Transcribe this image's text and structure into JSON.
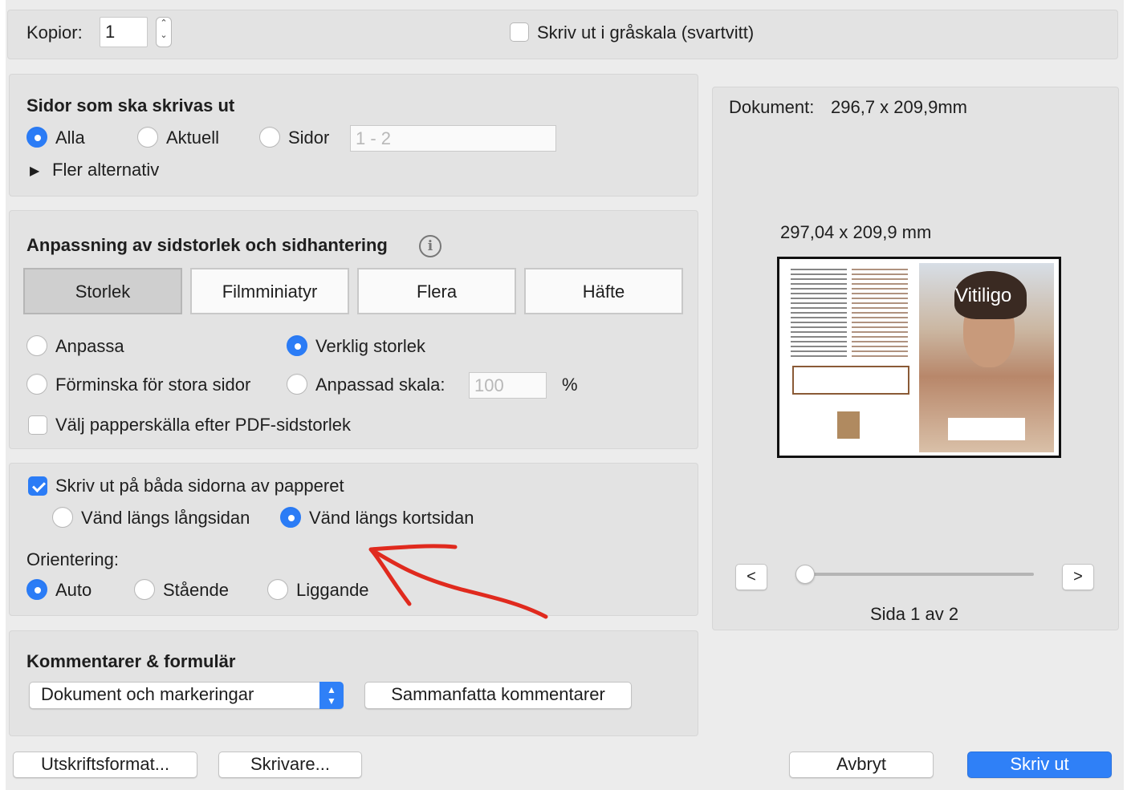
{
  "copies": {
    "label": "Kopior:",
    "value": "1"
  },
  "grayscale": {
    "label": "Skriv ut i gråskala (svartvitt)",
    "checked": false
  },
  "pages_section": {
    "title": "Sidor som ska skrivas ut",
    "options": [
      "Alla",
      "Aktuell",
      "Sidor"
    ],
    "selected": "Alla",
    "range_placeholder": "1 - 2",
    "more_options": "Fler alternativ"
  },
  "sizing_section": {
    "title": "Anpassning av sidstorlek och sidhantering",
    "info_icon": "info-icon",
    "tabs": [
      "Storlek",
      "Filmminiatyr",
      "Flera",
      "Häfte"
    ],
    "active_tab": "Storlek",
    "fit": "Anpassa",
    "actual_size": "Verklig storlek",
    "shrink": "Förminska för stora sidor",
    "custom_scale": "Anpassad skala:",
    "scale_value": "100",
    "percent": "%",
    "paper_source": "Välj papperskälla efter PDF-sidstorlek"
  },
  "duplex_section": {
    "both_sides": "Skriv ut på båda sidorna av papperet",
    "both_sides_checked": true,
    "flip_long": "Vänd längs långsidan",
    "flip_short": "Vänd längs kortsidan",
    "flip_selected": "short",
    "orientation_label": "Orientering:",
    "orientations": [
      "Auto",
      "Stående",
      "Liggande"
    ],
    "orientation_selected": "Auto"
  },
  "comments_section": {
    "title": "Kommentarer & formulär",
    "select_value": "Dokument och markeringar",
    "summarize": "Sammanfatta kommentarer"
  },
  "preview": {
    "document_label": "Dokument:",
    "document_size": "296,7 x 209,9mm",
    "page_size": "297,04 x 209,9 mm",
    "thumbnail_title": "Vitiligo",
    "prev": "<",
    "next": ">",
    "page_indicator": "Sida 1 av 2",
    "page_current": 1,
    "page_total": 2
  },
  "footer": {
    "page_setup": "Utskriftsformat...",
    "printer": "Skrivare...",
    "cancel": "Avbryt",
    "print": "Skriv ut"
  },
  "colors": {
    "accent": "#2f80f7",
    "annotation": "#e02a1e",
    "panel": "#e3e3e3",
    "window": "#ececec"
  }
}
